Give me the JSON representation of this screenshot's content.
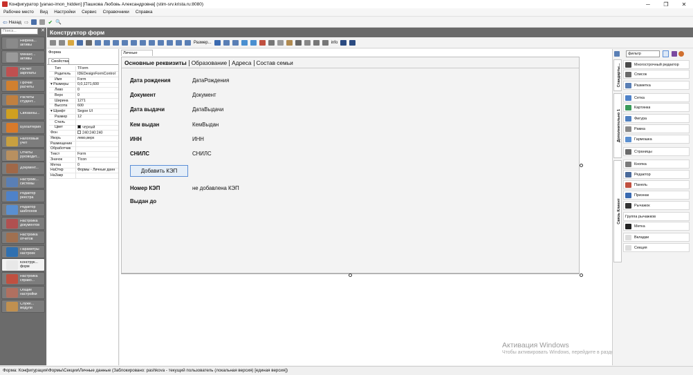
{
  "window": {
    "title": "Конфигуратор [yanao-imon_hidden] [Пашкова Любовь Александровна] (stim-srv.krista.ru:8080)"
  },
  "menu": [
    "Рабочее место",
    "Вид",
    "Настройки",
    "Сервис",
    "Справочники",
    "Справка"
  ],
  "nav": {
    "back_label": "Назад"
  },
  "sidebar": {
    "search_placeholder": "Поиск...",
    "items": [
      {
        "label": "Нефина... активы",
        "color": "#8a8a8a"
      },
      {
        "label": "Финанс... активы",
        "color": "#9a9a9a"
      },
      {
        "label": "Расчет зарплаты",
        "color": "#c05050"
      },
      {
        "label": "Прочие расчеты",
        "color": "#d08030"
      },
      {
        "label": "Расчеты студент...",
        "color": "#c08040"
      },
      {
        "label": "Связанны...",
        "color": "#d0a020"
      },
      {
        "label": "Бухгалтерия",
        "color": "#d87a2a"
      },
      {
        "label": "Налоговый учет",
        "color": "#c8a040"
      },
      {
        "label": "Отчеты руководит...",
        "color": "#b89060"
      },
      {
        "label": "Документ...",
        "color": "#a06848"
      },
      {
        "label": "Настройк... системы",
        "color": "#5a7fb5"
      },
      {
        "label": "Редактор реестра",
        "color": "#4f82c8"
      },
      {
        "label": "Редактор шаблонов",
        "color": "#5a8fd0"
      },
      {
        "label": "Настройка документов",
        "color": "#b05050"
      },
      {
        "label": "Настройка отчетов",
        "color": "#a07050"
      },
      {
        "label": "Параметры настроек",
        "color": "#3070b0"
      },
      {
        "label": "Конструк... форм",
        "color": "#e8e8e8"
      },
      {
        "label": "Настройка справо...",
        "color": "#c05040"
      },
      {
        "label": "Общие настройки",
        "color": "#b07060"
      },
      {
        "label": "Служе... модули",
        "color": "#c09050"
      }
    ]
  },
  "header": {
    "title": "Конструктор форм"
  },
  "toolbar": {
    "resize_label": "Размер...",
    "info_label": "info"
  },
  "properties": {
    "form_label": "Форма",
    "tab_label": "Свойства",
    "rows": [
      {
        "key": "Тип",
        "value": "TForm",
        "section": false
      },
      {
        "key": "Родитель",
        "value": "IDEDesignFormControl",
        "section": false
      },
      {
        "key": "Имя",
        "value": "Form",
        "section": false
      },
      {
        "key": "▾ Размеры",
        "value": "0,0,1271,600",
        "section": true
      },
      {
        "key": "Лево",
        "value": "0",
        "section": false
      },
      {
        "key": "Верх",
        "value": "0",
        "section": false
      },
      {
        "key": "Ширина",
        "value": "1271",
        "section": false
      },
      {
        "key": "Высота",
        "value": "600",
        "section": false
      },
      {
        "key": "▾ Шрифт",
        "value": "Segoe UI",
        "section": true
      },
      {
        "key": "Размер",
        "value": "12",
        "section": false
      },
      {
        "key": "Стиль",
        "value": "",
        "section": false
      },
      {
        "key": "Цвет",
        "value": "черный",
        "section": false,
        "swatch": "#000000"
      },
      {
        "key": "Фон",
        "value": "240:240:240",
        "section": true,
        "swatch": "#f0f0f0"
      },
      {
        "key": "Якорь",
        "value": "лево,верх",
        "section": true
      },
      {
        "key": "Размещение",
        "value": "",
        "section": true
      },
      {
        "key": "Обработчик",
        "value": "",
        "section": true
      },
      {
        "key": "Текст",
        "value": "Form",
        "section": true
      },
      {
        "key": "Значок",
        "value": "TIcon",
        "section": true
      },
      {
        "key": "Метка",
        "value": "0",
        "section": true
      },
      {
        "key": "НаОткр",
        "value": "Формы - Личные данн",
        "section": true
      },
      {
        "key": "НаЗакр",
        "value": "",
        "section": true
      }
    ]
  },
  "design": {
    "tab_label": "Личные данные",
    "form_tabs": [
      "Основные реквизиты",
      "Образование",
      "Адреса",
      "Состав семьи"
    ],
    "fields": [
      {
        "label": "Дата рождения",
        "value": "ДатаРождения"
      },
      {
        "label": "Документ",
        "value": "Документ"
      },
      {
        "label": "Дата выдачи",
        "value": "ДатаВыдачи"
      },
      {
        "label": "Кем выдан",
        "value": "КемВыдан"
      },
      {
        "label": "ИНН",
        "value": "ИНН"
      },
      {
        "label": "СНИЛС",
        "value": "СНИЛС"
      }
    ],
    "button_label": "Добавить КЭП",
    "kep_fields": [
      {
        "label": "Номер КЭП",
        "value": "не добавлена КЭП"
      },
      {
        "label": "Выдан до",
        "value": ""
      }
    ]
  },
  "watermark": {
    "line1": "Активация Windows",
    "line2": "Чтобы активировать Windows, перейдите в раздел \"Параметры\"."
  },
  "components": {
    "filter_value": "фильтр",
    "tabs": [
      "Стандарты...",
      "Дополнительно 1",
      "Связь Клиент"
    ],
    "items": [
      {
        "label": "Многострочный редактор",
        "color": "#4a4a4a"
      },
      {
        "label": "Список",
        "color": "#6a6a6a"
      },
      {
        "label": "Разметка",
        "color": "#5a7fb5"
      },
      {
        "label": "Сетка",
        "color": "#4f82c8"
      },
      {
        "label": "Картинка",
        "color": "#3a9a5a"
      },
      {
        "label": "Фигура",
        "color": "#5080c0"
      },
      {
        "label": "Рамка",
        "color": "#888888"
      },
      {
        "label": "Гармошка",
        "color": "#5a8fd0"
      },
      {
        "label": "Страницы",
        "color": "#6a6a6a"
      },
      {
        "label": "Кнопка",
        "color": "#7a7a7a"
      },
      {
        "label": "Редактор",
        "color": "#4a6a9a"
      },
      {
        "label": "Панель",
        "color": "#c05040"
      },
      {
        "label": "Признак",
        "color": "#3a6ab0"
      },
      {
        "label": "Рычажок",
        "color": "#333333"
      },
      {
        "label": "Группа рычажков",
        "color": ""
      },
      {
        "label": "Метка",
        "color": "#222222"
      },
      {
        "label": "Вкладки",
        "color": "#dddddd"
      },
      {
        "label": "Секция",
        "color": "#dddddd"
      }
    ]
  },
  "status": {
    "text": "Форма:     Конфигурация\\Формы\\Секции\\Личные данные (Заблокировано: pashkova - текущий пользователь (локальная версия) [единая версия])"
  }
}
